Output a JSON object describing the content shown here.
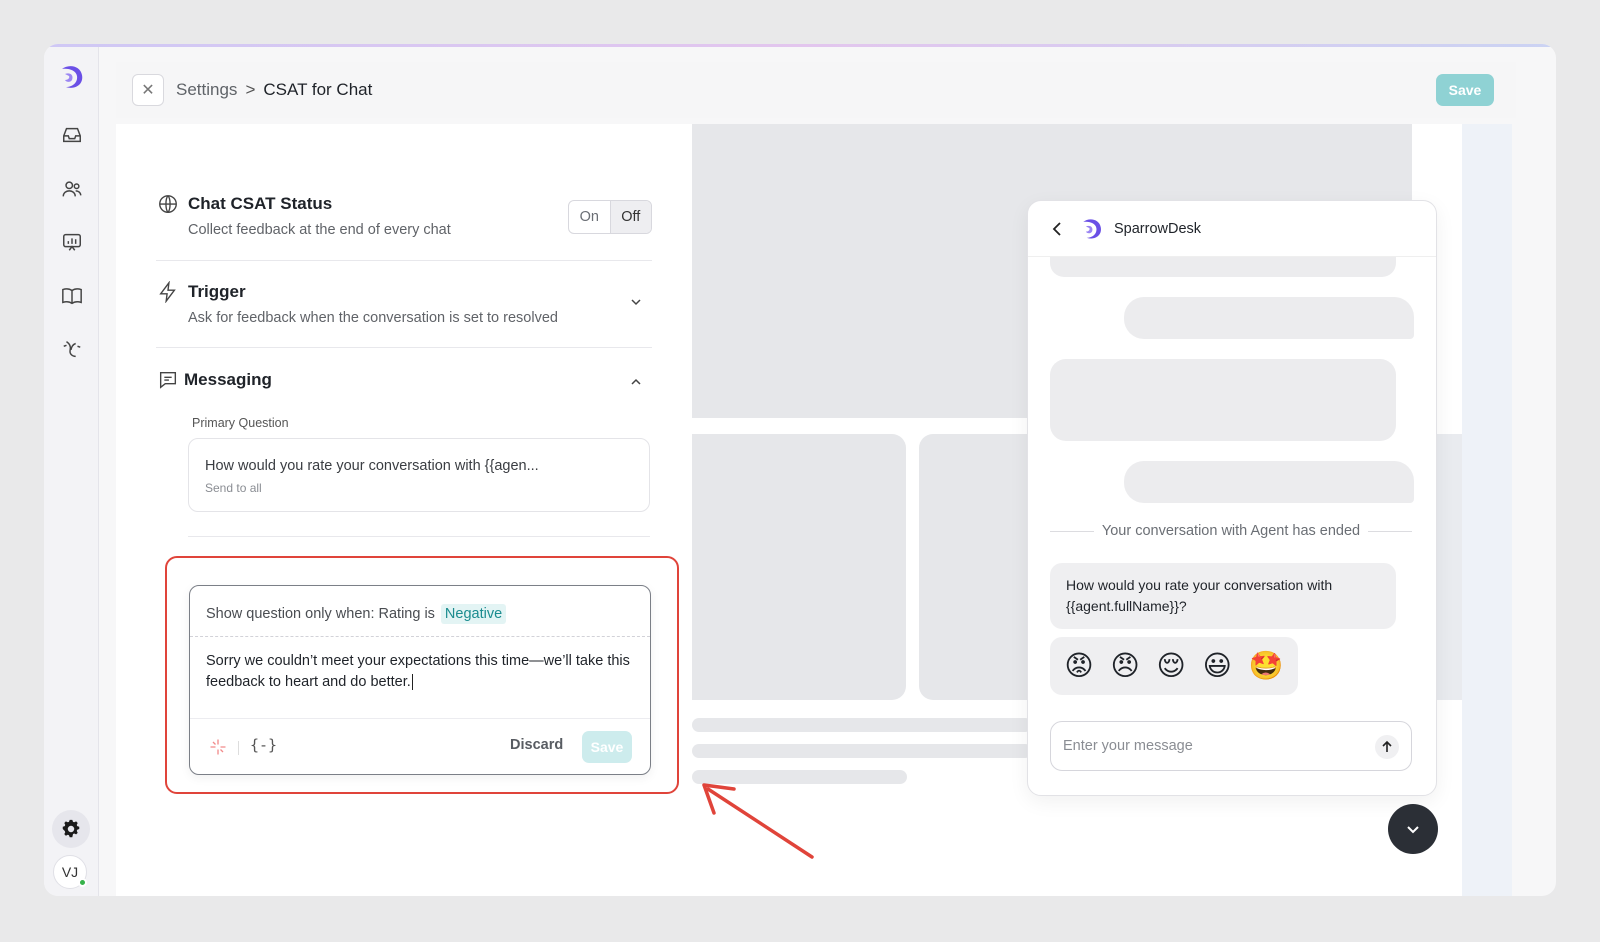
{
  "header": {
    "breadcrumb_parent": "Settings",
    "breadcrumb_sep": ">",
    "breadcrumb_current": "CSAT for Chat",
    "save_label": "Save"
  },
  "sidebar": {
    "items": [
      {
        "name": "inbox"
      },
      {
        "name": "contacts"
      },
      {
        "name": "reports"
      },
      {
        "name": "knowledge-base"
      },
      {
        "name": "automation"
      }
    ],
    "avatar_initials": "VJ"
  },
  "settings": {
    "status": {
      "title": "Chat CSAT Status",
      "description": "Collect feedback at the end of every chat",
      "toggle_on": "On",
      "toggle_off": "Off",
      "selected": "Off"
    },
    "trigger": {
      "title": "Trigger",
      "description": "Ask for feedback when the conversation is set to resolved"
    },
    "messaging": {
      "title": "Messaging",
      "primary_label": "Primary Question",
      "primary_text": "How would you rate your conversation with {{agen...",
      "primary_sub": "Send to all",
      "condition_prefix": "Show question only when: Rating is",
      "condition_value": "Negative",
      "followup_text": "Sorry we couldn’t meet your expectations this time—we’ll take this feedback to heart and do better.",
      "variable_icon": "{-}",
      "discard_label": "Discard",
      "save_label": "Save"
    }
  },
  "widget": {
    "brand": "SparrowDesk",
    "ended_text": "Your conversation with Agent has ended",
    "question": "How would you rate your conversation with {{agent.fullName}}?",
    "emojis": [
      "😡",
      "😠",
      "😌",
      "😃",
      "🤩"
    ],
    "input_placeholder": "Enter your message"
  },
  "colors": {
    "accent": "#8fd2d4",
    "brand": "#7b5cf0",
    "highlight": "#e0443a",
    "negative_tag": "#1b8c8f"
  }
}
